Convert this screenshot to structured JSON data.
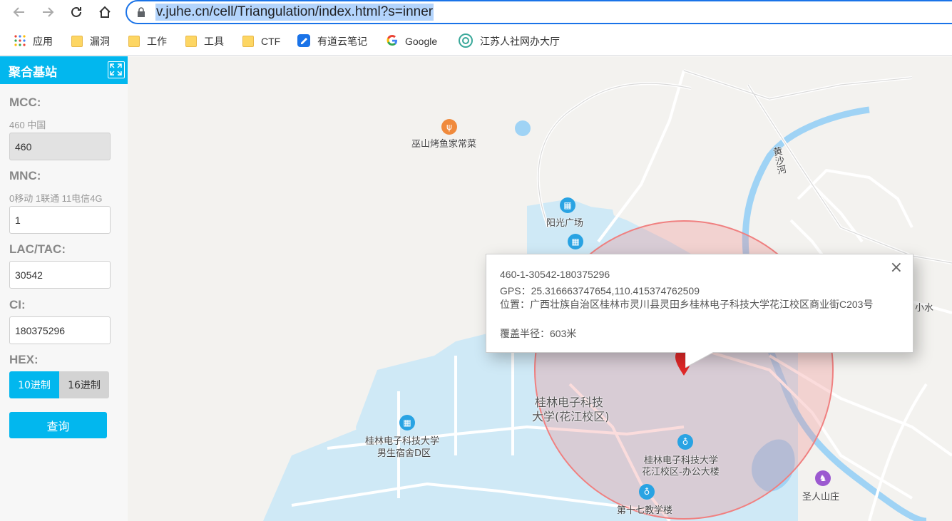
{
  "browser": {
    "url": "v.juhe.cn/cell/Triangulation/index.html?s=inner",
    "bookmarks": [
      "应用",
      "漏洞",
      "工作",
      "工具",
      "CTF",
      "有道云笔记",
      "Google",
      "江苏人社网办大厅"
    ]
  },
  "panel": {
    "title": "聚合基站",
    "mcc_label": "MCC:",
    "mcc_hint": "460 中国",
    "mcc_value": "460",
    "mnc_label": "MNC:",
    "mnc_hint": "0移动 1联通 11电信4G",
    "mnc_value": "1",
    "lac_label": "LAC/TAC:",
    "lac_value": "30542",
    "ci_label": "CI:",
    "ci_value": "180375296",
    "hex_label": "HEX:",
    "hex_dec": "10进制",
    "hex_hex": "16进制",
    "query": "查询"
  },
  "map": {
    "labels": {
      "restaurant": "巫山烤鱼家常菜",
      "river": "黄沙河",
      "square": "阳光广场",
      "campus_1": "桂林电子科技",
      "campus_2": "大学(花江校区)",
      "dorm_1": "桂林电子科技大学",
      "dorm_2": "男生宿舍D区",
      "office_1": "桂林电子科技大学",
      "office_2": "花江校区-办公大楼",
      "teaching": "第十七教学楼",
      "villa": "圣人山庄",
      "edge": "小水"
    }
  },
  "info": {
    "id": "460-1-30542-180375296",
    "gps": "GPS：25.316663747654,110.415374762509",
    "address": "位置：广西壮族自治区桂林市灵川县灵田乡桂林电子科技大学花江校区商业街C203号",
    "radius": "覆盖半径：603米",
    "close": "×"
  },
  "colors": {
    "accent": "#02b7ee",
    "circle": "#f08080",
    "water": "#9fd3f5",
    "campus": "#cfe9f6"
  }
}
